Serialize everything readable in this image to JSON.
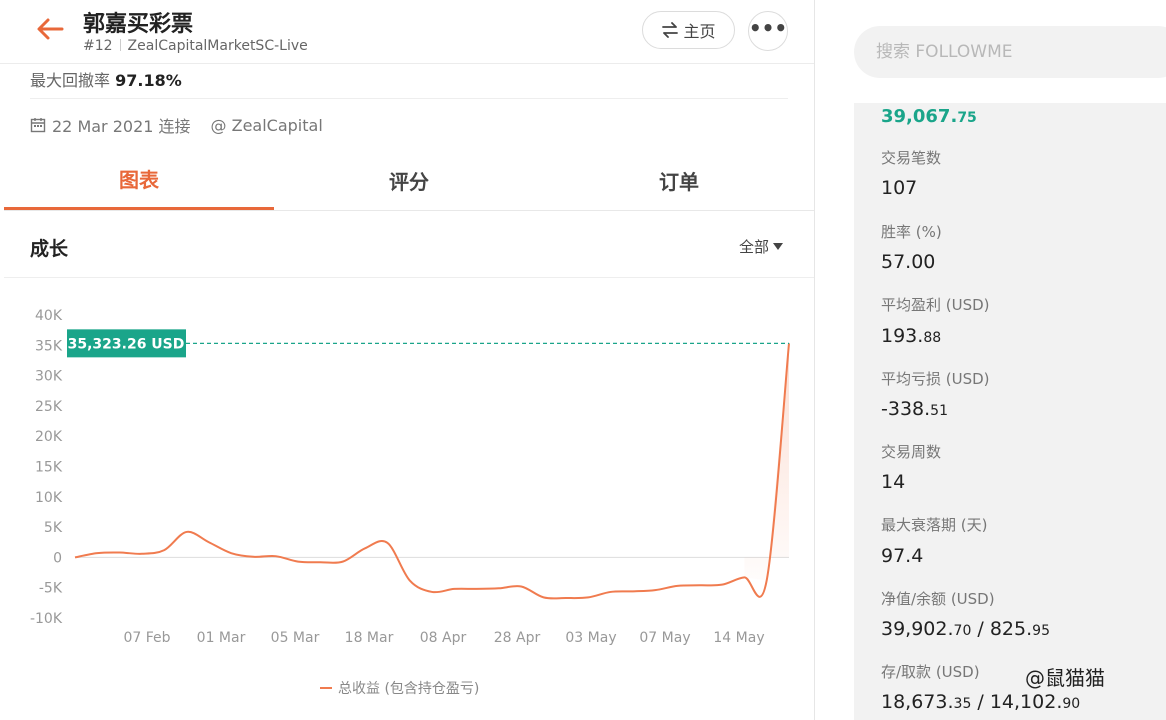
{
  "header": {
    "title": "郭嘉买彩票",
    "rank": "#12",
    "account": "ZealCapitalMarketSC-Live",
    "home_label": "主页"
  },
  "summary": {
    "drawdown_label": "最大回撤率",
    "drawdown_value": "97.18%",
    "connected_date": "22 Mar 2021 连接",
    "broker": "@ ZealCapital"
  },
  "tabs": [
    {
      "label": "图表",
      "active": true
    },
    {
      "label": "评分",
      "active": false
    },
    {
      "label": "订单",
      "active": false
    }
  ],
  "growth": {
    "title": "成长",
    "range": "全部"
  },
  "chart_data": {
    "type": "area",
    "series": [
      {
        "name": "总收益 (包含持仓盈亏)",
        "color": "#f07b4f",
        "values": [
          0,
          700,
          800,
          600,
          1200,
          4200,
          2500,
          700,
          100,
          200,
          -700,
          -800,
          -700,
          1500,
          2400,
          -3800,
          -5700,
          -5200,
          -5200,
          -5100,
          -4800,
          -6600,
          -6700,
          -6600,
          -5700,
          -5600,
          -5400,
          -4700,
          -4600,
          -4500,
          -3300,
          -3800,
          35323.26
        ]
      }
    ],
    "x_ticks": [
      "07 Feb",
      "01 Mar",
      "05 Mar",
      "18 Mar",
      "08 Apr",
      "28 Apr",
      "03 May",
      "07 May",
      "14 May"
    ],
    "y_ticks": [
      "40K",
      "35K",
      "30K",
      "25K",
      "20K",
      "15K",
      "10K",
      "5K",
      "0",
      "-5K",
      "-10K"
    ],
    "ylim": [
      -10000,
      40000
    ],
    "current_value_label": "35,323.26 USD",
    "current_value": 35323.26,
    "label_color": "#1aa58a"
  },
  "search": {
    "placeholder": "搜索 FOLLOWME"
  },
  "stats": {
    "top_value_main": "39,067.",
    "top_value_dec": "75",
    "items": [
      {
        "label": "交易笔数",
        "main": "107",
        "dec": ""
      },
      {
        "label": "胜率 (%)",
        "main": "57.00",
        "dec": ""
      },
      {
        "label": "平均盈利 (USD)",
        "main": "193.",
        "dec": "88"
      },
      {
        "label": "平均亏损 (USD)",
        "main": "-338.",
        "dec": "51"
      },
      {
        "label": "交易周数",
        "main": "14",
        "dec": ""
      },
      {
        "label": "最大衰落期 (天)",
        "main": "97.4",
        "dec": ""
      },
      {
        "label": "净值/余额 (USD)",
        "main": "39,902.",
        "dec": "70",
        "main2": " / 825.",
        "dec2": "95"
      },
      {
        "label": "存/取款 (USD)",
        "main": "18,673.",
        "dec": "35",
        "main2": " / 14,102.",
        "dec2": "90"
      }
    ]
  },
  "watermark": "@鼠猫猫"
}
